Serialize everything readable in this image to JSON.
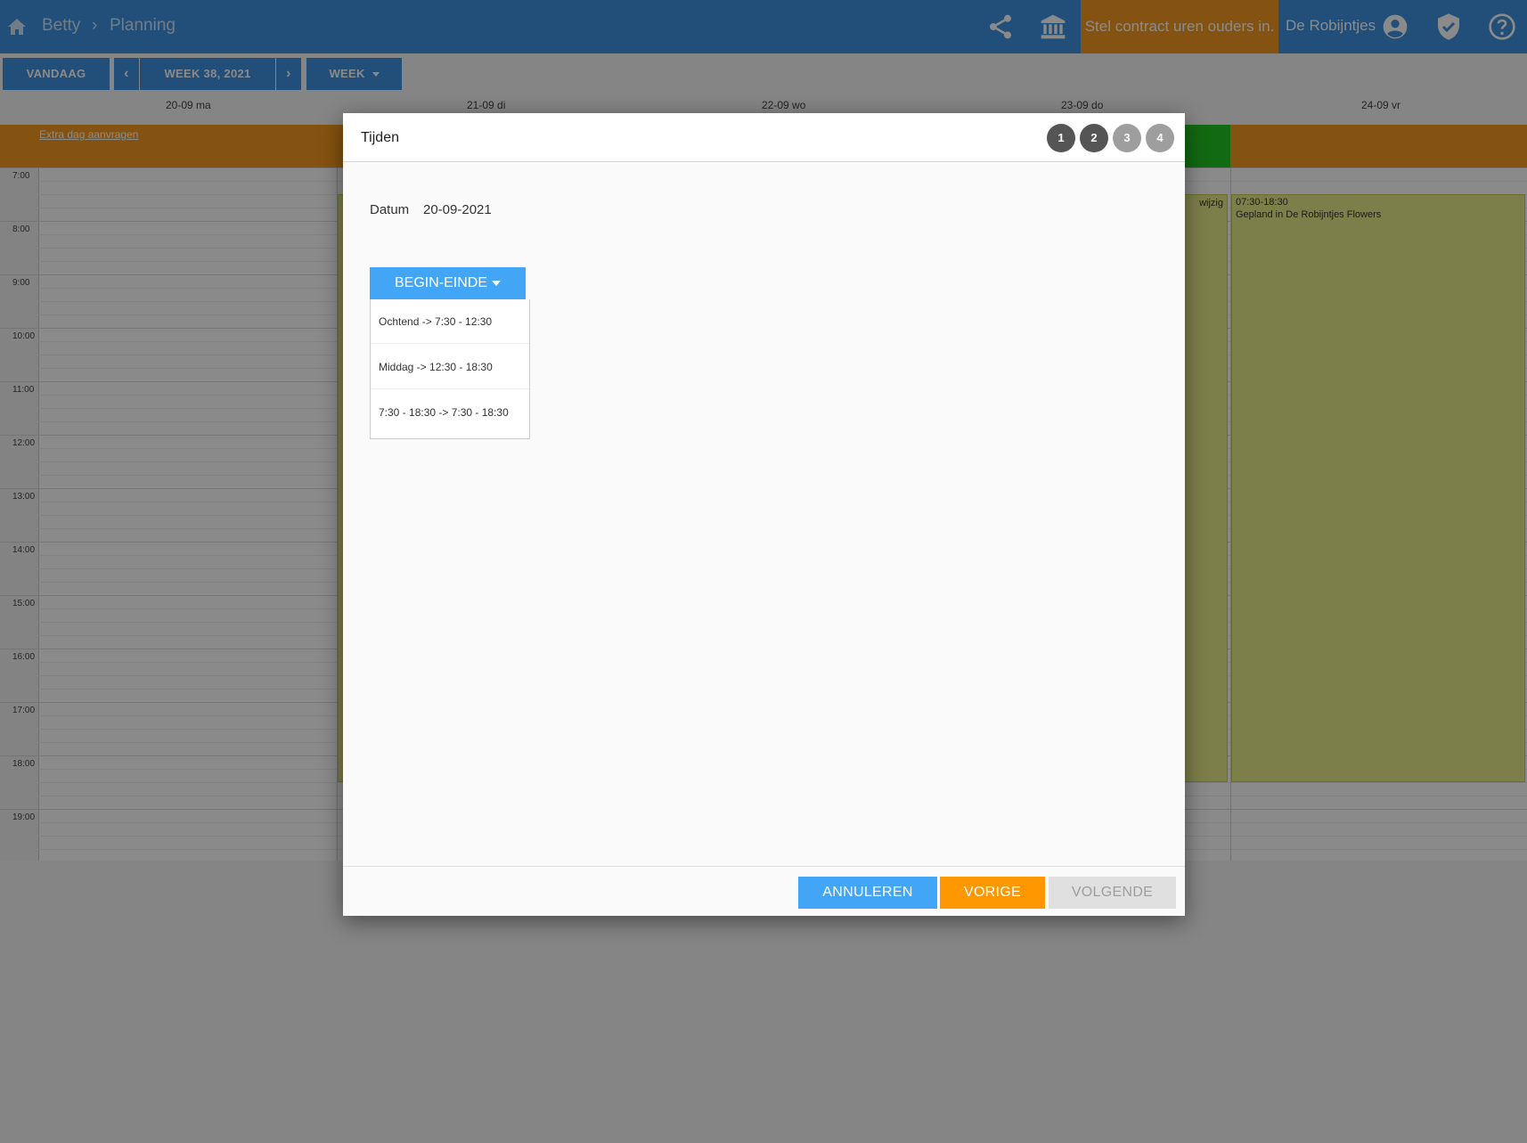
{
  "header": {
    "breadcrumb": [
      "Betty",
      "Planning"
    ],
    "separator": "›",
    "contract_notice": "Stel contract uren ouders in.",
    "organization": "De Robijntjes"
  },
  "toolbar": {
    "today_label": "VANDAAG",
    "prev_label": "‹",
    "week_label": "WEEK 38, 2021",
    "next_label": "›",
    "view_label": "WEEK"
  },
  "calendar": {
    "days": [
      "20-09 ma",
      "21-09 di",
      "22-09 wo",
      "23-09 do",
      "24-09 vr"
    ],
    "extra_day_link": "Extra dag aanvragen",
    "hours": [
      "7:00",
      "8:00",
      "9:00",
      "10:00",
      "11:00",
      "12:00",
      "13:00",
      "14:00",
      "15:00",
      "16:00",
      "17:00",
      "18:00",
      "19:00"
    ],
    "event_edit_label": "wijzig",
    "event": {
      "time": "07:30-18:30",
      "description": "Gepland in De Robijntjes Flowers"
    }
  },
  "modal": {
    "title": "Tijden",
    "steps": [
      "1",
      "2",
      "3",
      "4"
    ],
    "date_label": "Datum",
    "date_value": "20-09-2021",
    "dropdown_label": "BEGIN-EINDE",
    "options": [
      "Ochtend -> 7:30 - 12:30",
      "Middag -> 12:30 - 18:30",
      "7:30 - 18:30 -> 7:30 - 18:30"
    ],
    "cancel_label": "ANNULEREN",
    "previous_label": "VORIGE",
    "next_label": "VOLGENDE"
  },
  "colors": {
    "primary": "#3d93e0",
    "accent_orange": "#f59a20",
    "green": "#22c422",
    "event_fill": "#e8ea8a",
    "step_active": "#555555",
    "step_inactive": "#9e9e9e"
  }
}
